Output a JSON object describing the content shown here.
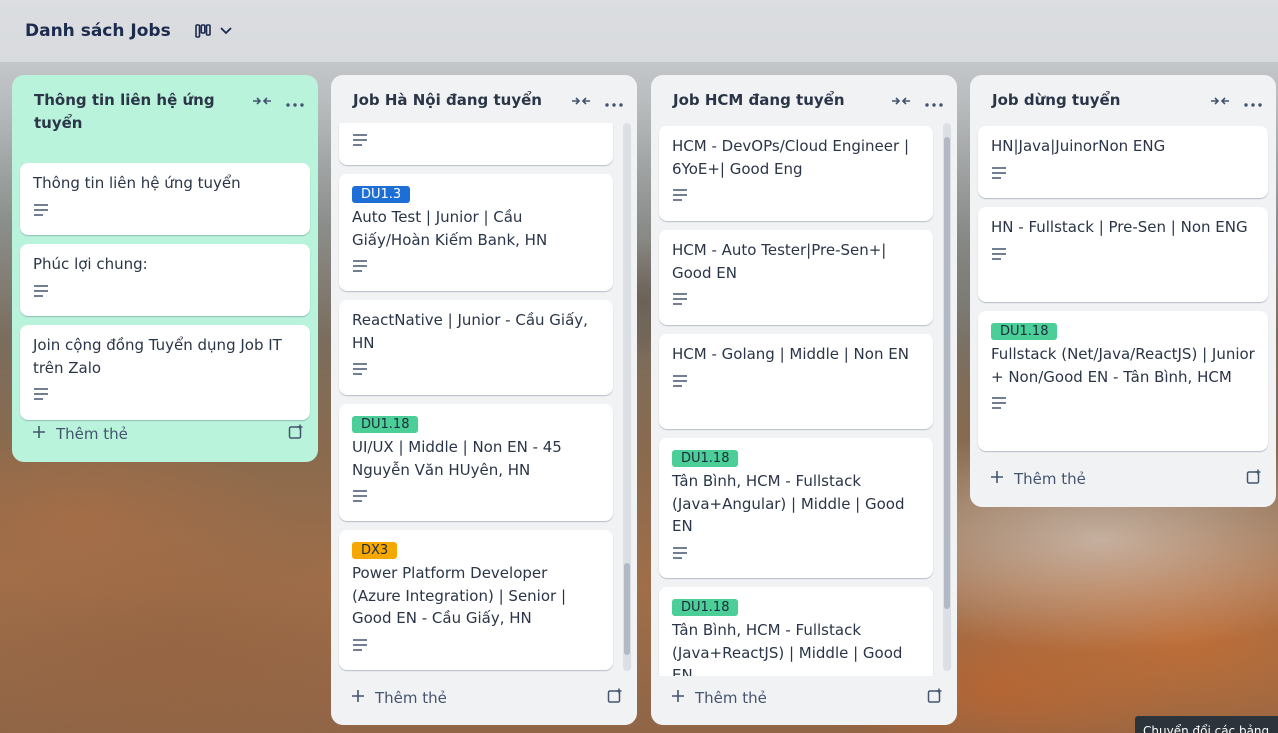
{
  "board": {
    "title": "Danh sách Jobs",
    "view_icon": "board-view-icon",
    "chevron_icon": "chevron-down-icon"
  },
  "add_card_label": "Thêm thẻ",
  "lists": [
    {
      "title": "Thông tin liên hệ ứng tuyển",
      "cards": [
        {
          "text": "Thông tin liên hệ ứng tuyển"
        },
        {
          "text": "Phúc lợi chung:"
        },
        {
          "text": "Join cộng đồng Tuyển dụng Job IT trên Zalo"
        }
      ]
    },
    {
      "title": "Job Hà Nội đang tuyển",
      "cards": [
        {
          "text": ""
        },
        {
          "label": "DU1.3",
          "text": "Auto Test | Junior | Cầu Giấy/Hoàn Kiếm Bank, HN"
        },
        {
          "text": "ReactNative | Junior - Cầu Giấy, HN"
        },
        {
          "label": "DU1.18",
          "text": "UI/UX | Middle | Non EN - 45 Nguyễn Văn HUyên, HN"
        },
        {
          "label": "DX3",
          "text": "Power Platform Developer (Azure Integration) | Senior | Good EN - Cầu Giấy, HN"
        }
      ]
    },
    {
      "title": "Job HCM đang tuyển",
      "cards": [
        {
          "text": "HCM - DevOPs/Cloud Engineer | 6YoE+| Good Eng"
        },
        {
          "text": "HCM - Auto Tester|Pre-Sen+| Good EN"
        },
        {
          "text": "HCM - Golang | Middle | Non EN"
        },
        {
          "label": "DU1.18",
          "text": "Tân Bình, HCM - Fullstack (Java+Angular) | Middle | Good EN"
        },
        {
          "label": "DU1.18",
          "text": "Tân Bình, HCM - Fullstack (Java+ReactJS) | Middle | Good EN"
        }
      ]
    },
    {
      "title": "Job dừng tuyển",
      "cards": [
        {
          "text": "HN|Java|JuinorNon ENG"
        },
        {
          "text": "HN - Fullstack | Pre-Sen | Non ENG"
        },
        {
          "label": "DU1.18",
          "text": "Fullstack (Net/Java/ReactJS) | Junior + Non/Good EN - Tân Bình, HCM"
        }
      ]
    }
  ],
  "tooltip": "Chuyển đổi các bảng"
}
